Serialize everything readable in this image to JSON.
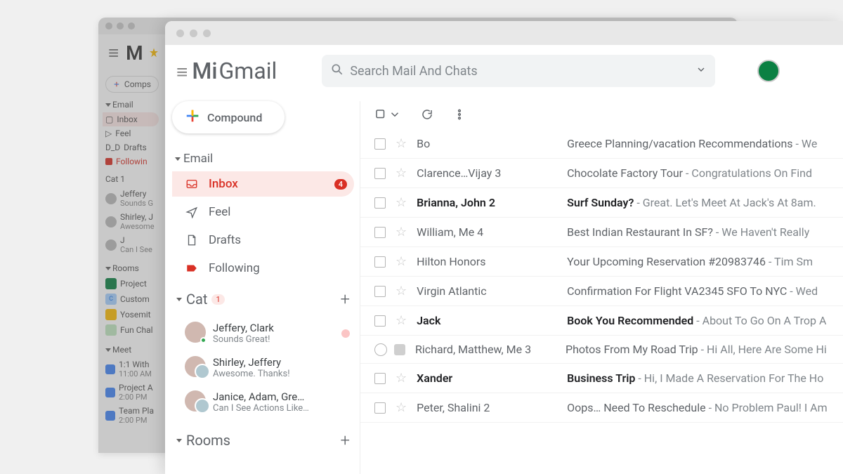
{
  "colors": {
    "accent_red": "#d93025",
    "bg_gray": "#f1f3f4",
    "text_primary": "#202124",
    "text_secondary": "#5f6368"
  },
  "bg": {
    "logo": "M",
    "compose": "Comps",
    "email_section": "Email",
    "items": {
      "inbox": "Inbox",
      "feel": "Feel",
      "drafts": "Drafts",
      "drafts_prefix": "D_D",
      "following": "Followin"
    },
    "cat_section": "Cat 1",
    "chats": [
      {
        "name": "Jeffery",
        "preview": "Sounds G"
      },
      {
        "name": "Shirley, J",
        "preview": "Awesome"
      },
      {
        "name": "J",
        "preview": "Can I See"
      }
    ],
    "rooms_section": "Rooms",
    "rooms": [
      {
        "name": "Project"
      },
      {
        "name": "Custom",
        "badge": "C"
      },
      {
        "name": "Yosemit"
      },
      {
        "name": "Fun Chal"
      }
    ],
    "meet_section": "Meet",
    "meets": [
      {
        "title": "1:1 With",
        "time": "11:00 AM"
      },
      {
        "title": "Project A",
        "time": "2:00 PM"
      },
      {
        "title": "Team Pla",
        "time": "2:00 PM"
      }
    ]
  },
  "brand": {
    "prefix": "Mi",
    "name": "Gmail"
  },
  "search": {
    "placeholder": "Search Mail And Chats"
  },
  "compose_label": "Compound",
  "sidebar": {
    "email_section": "Email",
    "items": [
      {
        "key": "inbox",
        "label": "Inbox",
        "badge": "4",
        "selected": true
      },
      {
        "key": "feel",
        "label": "Feel"
      },
      {
        "key": "drafts",
        "label": "Drafts"
      },
      {
        "key": "following",
        "label": "Following"
      }
    ],
    "cat_section": "Cat",
    "cat_badge": "1",
    "chats": [
      {
        "name": "Jeffery, Clark",
        "preview": "Sounds Great!",
        "status": true
      },
      {
        "name": "Shirley, Jeffery",
        "preview": "Awesome. Thanks!"
      },
      {
        "name": "Janice, Adam, Gre…",
        "preview": "Can I See Actions Like…"
      }
    ],
    "rooms_section": "Rooms"
  },
  "messages": [
    {
      "unread": false,
      "sender": "Bo",
      "subject": "Greece Planning/vacation Recommendations",
      "snippet": " - We"
    },
    {
      "unread": false,
      "sender": "Clarence…Vijay 3",
      "subject": "Chocolate Factory Tour",
      "snippet": " - Congratulations On Find"
    },
    {
      "unread": true,
      "sender": "Brianna, John 2",
      "subject": "Surf Sunday?",
      "snippet": " - Great. Let's Meet At Jack's At 8am."
    },
    {
      "unread": false,
      "sender": "William, Me 4",
      "subject": "Best Indian Restaurant In SF?",
      "snippet": " - We Haven't Really"
    },
    {
      "unread": false,
      "sender": "Hilton Honors",
      "subject": "Your Upcoming Reservation #20983746",
      "snippet": " - Tim Sm"
    },
    {
      "unread": false,
      "sender": "Virgin Atlantic",
      "subject": "Confirmation For Flight VA2345 SFO To NYC",
      "snippet": " - Wed"
    },
    {
      "unread": true,
      "sender": "Jack",
      "subject": "Book You Recommended",
      "snippet": " - About To Go On A Trop A"
    },
    {
      "unread": false,
      "sender": "Richard, Matthew, Me 3",
      "subject": "Photos From My Road Trip",
      "snippet": " - Hi All, Here Are Some Hi",
      "radio": true
    },
    {
      "unread": true,
      "sender": "Xander",
      "subject": "Business Trip",
      "snippet": " - Hi, I Made A Reservation For The Ho"
    },
    {
      "unread": false,
      "sender": "Peter, Shalini 2",
      "subject": "Oops… Need To Reschedule",
      "snippet": " - No Problem Paul! I Am"
    }
  ]
}
